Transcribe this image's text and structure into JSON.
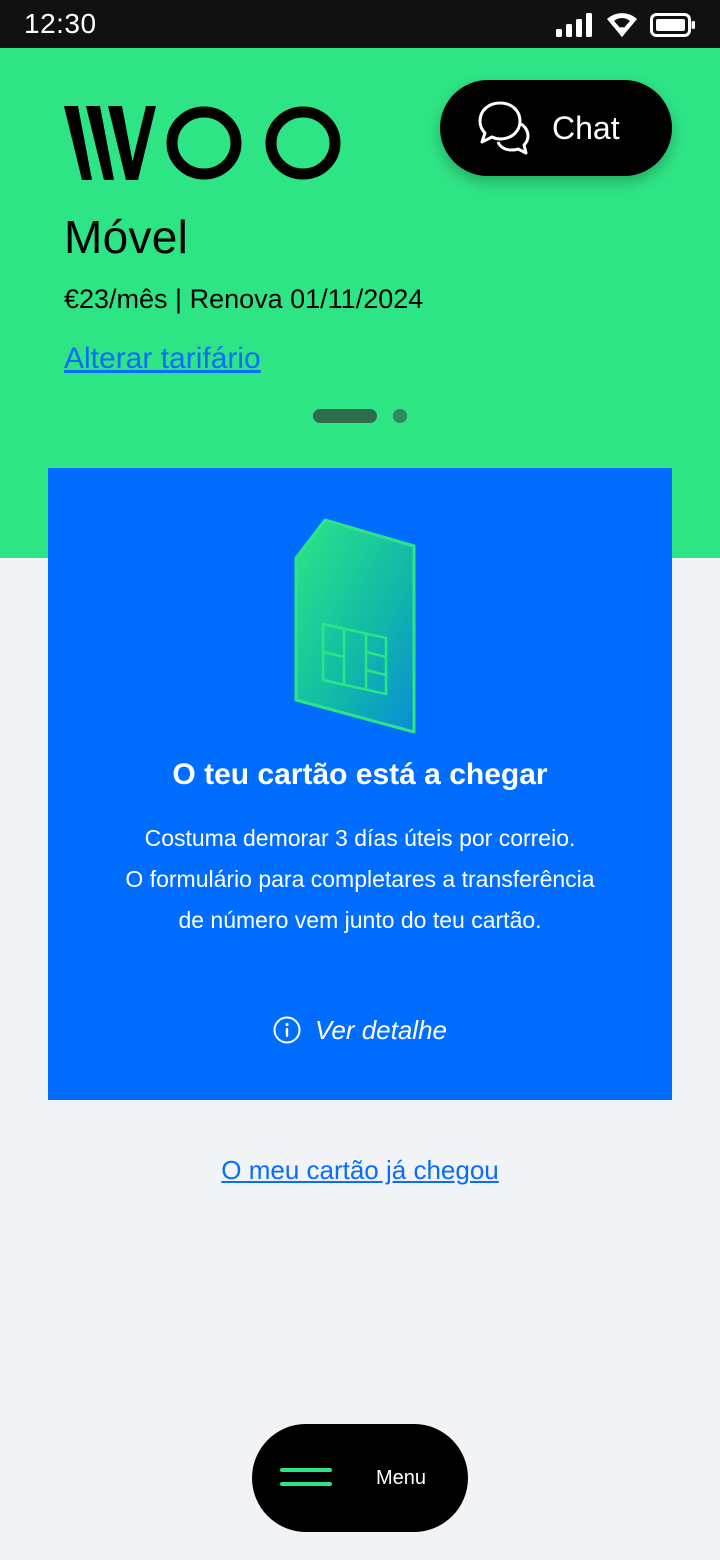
{
  "status_bar": {
    "time": "12:30",
    "icons": [
      "signal-icon",
      "wifi-icon",
      "battery-icon"
    ]
  },
  "header": {
    "logo_text": "WOO",
    "chat_label": "Chat",
    "chat_icon": "chat-bubbles-icon"
  },
  "plan": {
    "title": "Móvel",
    "info": "€23/mês | Renova 01/11/2024",
    "change_link": "Alterar tarifário",
    "pager": {
      "count": 2,
      "active_index": 0
    }
  },
  "card": {
    "illustration": "sim-card-icon",
    "title": "O teu cartão está a chegar",
    "text_lines": [
      "Costuma demorar 3 días úteis por correio.",
      "O formulário para completares a transferência",
      "de número vem junto do teu cartão."
    ],
    "detail_icon": "info-icon",
    "detail_label": "Ver detalhe"
  },
  "arrived_link": "O meu cartão já chegou",
  "bottom_menu": {
    "label": "Menu",
    "icon": "hamburger-icon"
  },
  "colors": {
    "brand_green": "#2ee585",
    "card_blue": "#006dff",
    "link_blue": "#0a6cff",
    "background": "#f1f3f6"
  }
}
